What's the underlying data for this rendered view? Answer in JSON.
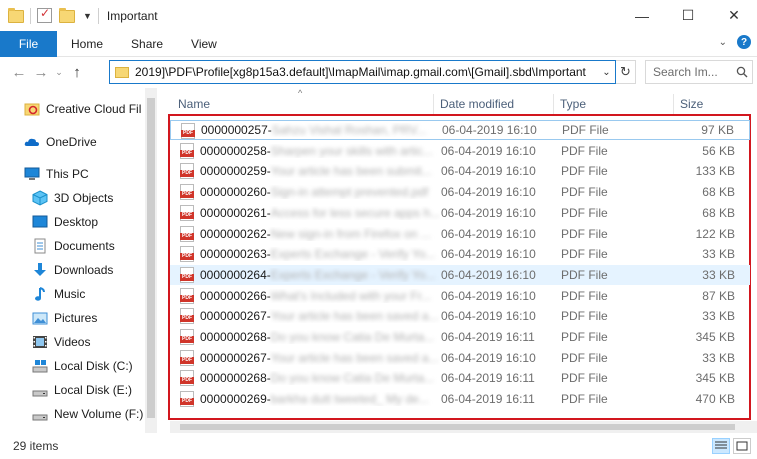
{
  "window": {
    "title": "Important",
    "minimize": "—",
    "maximize": "☐",
    "close": "✕"
  },
  "ribbon": {
    "file": "File",
    "tabs": [
      "Home",
      "Share",
      "View"
    ],
    "help": "?"
  },
  "nav": {
    "back": "←",
    "forward": "→",
    "recent": "⌄",
    "up": "↑",
    "address": "2019]\\PDF\\Profile[xg8p15a3.default]\\ImapMail\\imap.gmail.com\\[Gmail].sbd\\Important",
    "refresh": "↻",
    "search_placeholder": "Search Im..."
  },
  "sidebar": {
    "items": [
      {
        "label": "Creative Cloud Fil",
        "icon": "creative-cloud-icon"
      },
      {
        "label": "OneDrive",
        "icon": "onedrive-icon"
      },
      {
        "label": "This PC",
        "icon": "computer-icon"
      },
      {
        "label": "3D Objects",
        "icon": "cube-icon"
      },
      {
        "label": "Desktop",
        "icon": "desktop-icon"
      },
      {
        "label": "Documents",
        "icon": "document-icon"
      },
      {
        "label": "Downloads",
        "icon": "download-icon"
      },
      {
        "label": "Music",
        "icon": "music-icon"
      },
      {
        "label": "Pictures",
        "icon": "pictures-icon"
      },
      {
        "label": "Videos",
        "icon": "video-icon"
      },
      {
        "label": "Local Disk (C:)",
        "icon": "drive-icon"
      },
      {
        "label": "Local Disk (E:)",
        "icon": "drive-icon"
      },
      {
        "label": "New Volume (F:)",
        "icon": "drive-icon"
      }
    ]
  },
  "columns": {
    "name": "Name",
    "date": "Date modified",
    "type": "Type",
    "size": "Size"
  },
  "files": [
    {
      "id": "0000000257-",
      "blur": "Sahzu Vishal Roshan, PRV...",
      "date": "06-04-2019 16:10",
      "type": "PDF File",
      "size": "97 KB"
    },
    {
      "id": "0000000258-",
      "blur": "Sharpen your skills with artic...",
      "date": "06-04-2019 16:10",
      "type": "PDF File",
      "size": "56 KB"
    },
    {
      "id": "0000000259-",
      "blur": "Your article has been submit...",
      "date": "06-04-2019 16:10",
      "type": "PDF File",
      "size": "133 KB"
    },
    {
      "id": "0000000260-",
      "blur": "Sign-in attempt prevented.pdf",
      "date": "06-04-2019 16:10",
      "type": "PDF File",
      "size": "68 KB"
    },
    {
      "id": "0000000261-",
      "blur": "Access for less secure apps h...",
      "date": "06-04-2019 16:10",
      "type": "PDF File",
      "size": "68 KB"
    },
    {
      "id": "0000000262-",
      "blur": "New sign-in from Firefox on ...",
      "date": "06-04-2019 16:10",
      "type": "PDF File",
      "size": "122 KB"
    },
    {
      "id": "0000000263-",
      "blur": "Experts Exchange - Verify Yo...",
      "date": "06-04-2019 16:10",
      "type": "PDF File",
      "size": "33 KB"
    },
    {
      "id": "0000000264-",
      "blur": "Experts Exchange - Verify Yo...",
      "date": "06-04-2019 16:10",
      "type": "PDF File",
      "size": "33 KB"
    },
    {
      "id": "0000000266-",
      "blur": "What's Included with your Fr...",
      "date": "06-04-2019 16:10",
      "type": "PDF File",
      "size": "87 KB"
    },
    {
      "id": "0000000267-",
      "blur": "Your article has been saved a...",
      "date": "06-04-2019 16:10",
      "type": "PDF File",
      "size": "33 KB"
    },
    {
      "id": "0000000268-",
      "blur": "Do you know Catia De Murta...",
      "date": "06-04-2019 16:11",
      "type": "PDF File",
      "size": "345 KB"
    },
    {
      "id": "0000000267-",
      "blur": "Your article has been saved a...",
      "date": "06-04-2019 16:10",
      "type": "PDF File",
      "size": "33 KB"
    },
    {
      "id": "0000000268-",
      "blur": "Do you know Catia De Murta...",
      "date": "06-04-2019 16:11",
      "type": "PDF File",
      "size": "345 KB"
    },
    {
      "id": "0000000269-",
      "blur": "barkha dutt tweeted_ My de...",
      "date": "06-04-2019 16:11",
      "type": "PDF File",
      "size": "470 KB"
    }
  ],
  "status": {
    "item_count": "29 items"
  },
  "colors": {
    "accent": "#1979ca",
    "highlight_border": "#d2161e",
    "selection": "#e5f3ff"
  }
}
